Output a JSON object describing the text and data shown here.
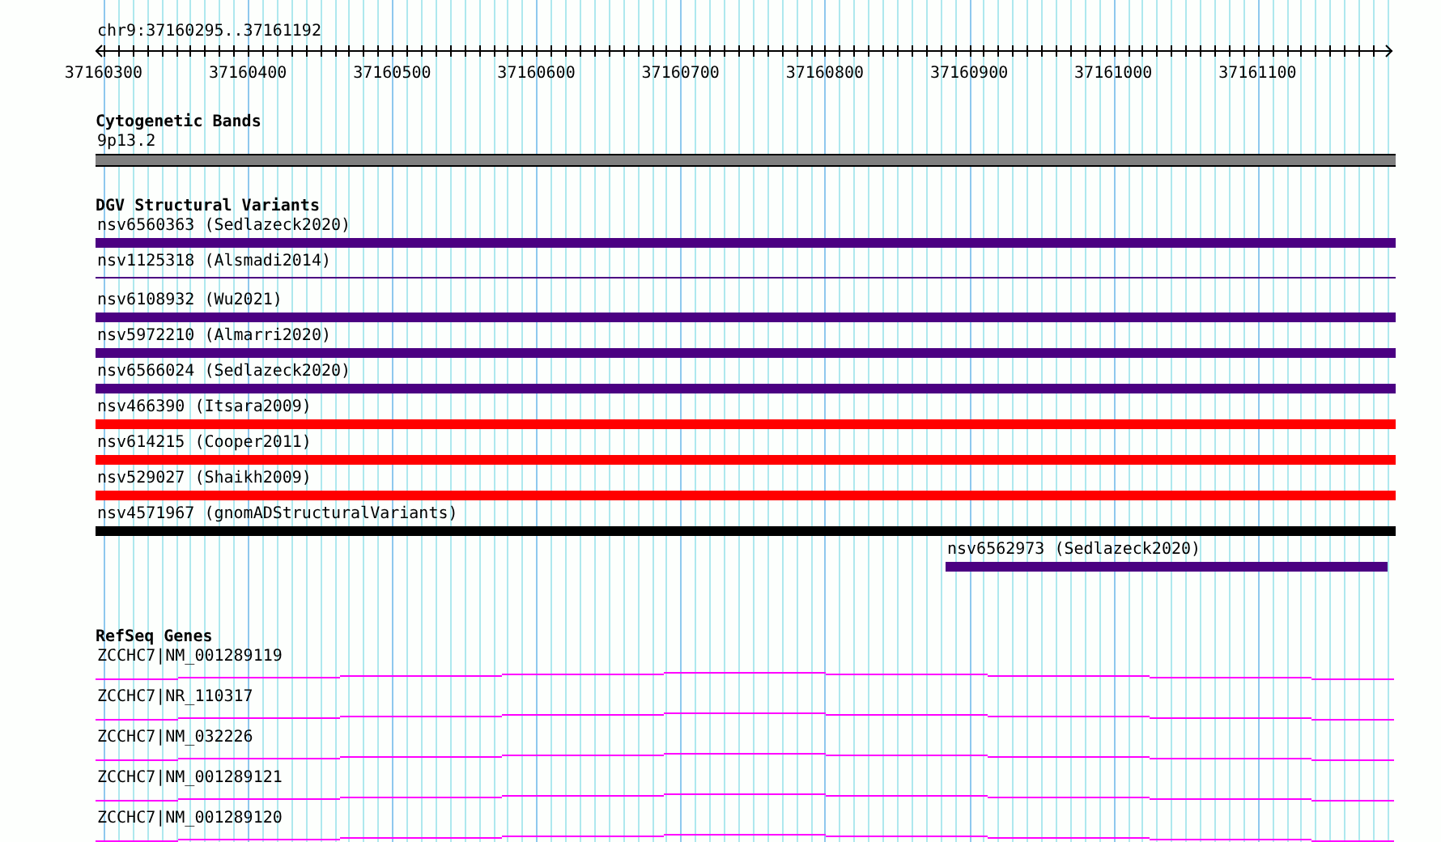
{
  "position": "chr9:37160295..37161192",
  "ruler": {
    "ticks": [
      "37160300",
      "37160400",
      "37160500",
      "37160600",
      "37160700",
      "37160800",
      "37160900",
      "37161000",
      "37161100"
    ]
  },
  "tracks": [
    {
      "kind": "band",
      "title": "Cytogenetic Bands",
      "features": [
        {
          "label": "9p13.2",
          "color": "#808080"
        }
      ]
    },
    {
      "kind": "variant",
      "title": "DGV Structural Variants",
      "features": [
        {
          "label": "nsv6560363 (Sedlazeck2020)",
          "kind": "thick",
          "color": "#4b0082"
        },
        {
          "label": "nsv1125318 (Alsmadi2014)",
          "kind": "thin",
          "color": "#4b0082"
        },
        {
          "label": "nsv6108932 (Wu2021)",
          "kind": "thick",
          "color": "#4b0082"
        },
        {
          "label": "nsv5972210 (Almarri2020)",
          "kind": "thick",
          "color": "#4b0082"
        },
        {
          "label": "nsv6566024 (Sedlazeck2020)",
          "kind": "thick",
          "color": "#4b0082"
        },
        {
          "label": "nsv466390 (Itsara2009)",
          "kind": "thick",
          "color": "#ff0000"
        },
        {
          "label": "nsv614215 (Cooper2011)",
          "kind": "thick",
          "color": "#ff0000"
        },
        {
          "label": "nsv529027 (Shaikh2009)",
          "kind": "thick",
          "color": "#ff0000"
        },
        {
          "label": "nsv4571967 (gnomADStructuralVariants)",
          "kind": "thick",
          "color": "#000000"
        },
        {
          "label": "nsv6562973 (Sedlazeck2020)",
          "kind": "offset",
          "color": "#4b0082"
        }
      ]
    },
    {
      "kind": "gene",
      "title": "RefSeq Genes",
      "features": [
        {
          "label": "ZCCHC7|NM_001289119"
        },
        {
          "label": "ZCCHC7|NR_110317"
        },
        {
          "label": "ZCCHC7|NM_032226"
        },
        {
          "label": "ZCCHC7|NM_001289121"
        },
        {
          "label": "ZCCHC7|NM_001289120"
        }
      ]
    }
  ]
}
